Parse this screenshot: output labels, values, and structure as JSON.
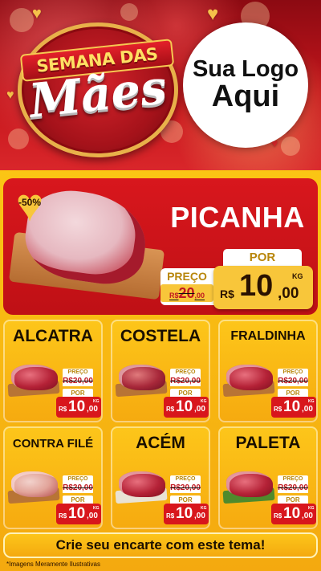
{
  "header": {
    "title_line1": "SEMANA DAS",
    "title_line2": "Mães",
    "logo_line1": "Sua Logo",
    "logo_line2": "Aqui"
  },
  "featured": {
    "discount": "-50%",
    "name": "PICANHA",
    "preco_label": "PREÇO",
    "old_currency": "R$",
    "old_int": "20",
    "old_dec": ",00",
    "por_label": "POR",
    "currency": "R$",
    "price_int": "10",
    "price_dec": ",00",
    "unit": "KG"
  },
  "products": [
    {
      "name": "ALCATRA",
      "preco_label": "PREÇO",
      "old": "R$20,00",
      "por_label": "POR",
      "currency": "R$",
      "price_int": "10",
      "price_dec": ",00",
      "unit": "KG"
    },
    {
      "name": "COSTELA",
      "preco_label": "PREÇO",
      "old": "R$20,00",
      "por_label": "POR",
      "currency": "R$",
      "price_int": "10",
      "price_dec": ",00",
      "unit": "KG"
    },
    {
      "name": "FRALDINHA",
      "preco_label": "PREÇO",
      "old": "R$20,00",
      "por_label": "POR",
      "currency": "R$",
      "price_int": "10",
      "price_dec": ",00",
      "unit": "KG"
    },
    {
      "name": "CONTRA FILÉ",
      "preco_label": "PREÇO",
      "old": "R$20,00",
      "por_label": "POR",
      "currency": "R$",
      "price_int": "10",
      "price_dec": ",00",
      "unit": "KG"
    },
    {
      "name": "ACÉM",
      "preco_label": "PREÇO",
      "old": "R$20,00",
      "por_label": "POR",
      "currency": "R$",
      "price_int": "10",
      "price_dec": ",00",
      "unit": "KG"
    },
    {
      "name": "PALETA",
      "preco_label": "PREÇO",
      "old": "R$20,00",
      "por_label": "POR",
      "currency": "R$",
      "price_int": "10",
      "price_dec": ",00",
      "unit": "KG"
    }
  ],
  "footer": {
    "cta": "Crie seu encarte com este tema!",
    "disclaimer": "*Imagens Meramente Ilustrativas"
  },
  "colors": {
    "red": "#d8171d",
    "yellow": "#fbc514",
    "gold": "#f8c63a"
  },
  "icons": {
    "discount_badge": "heart-icon",
    "decoration": "heart-icon"
  }
}
